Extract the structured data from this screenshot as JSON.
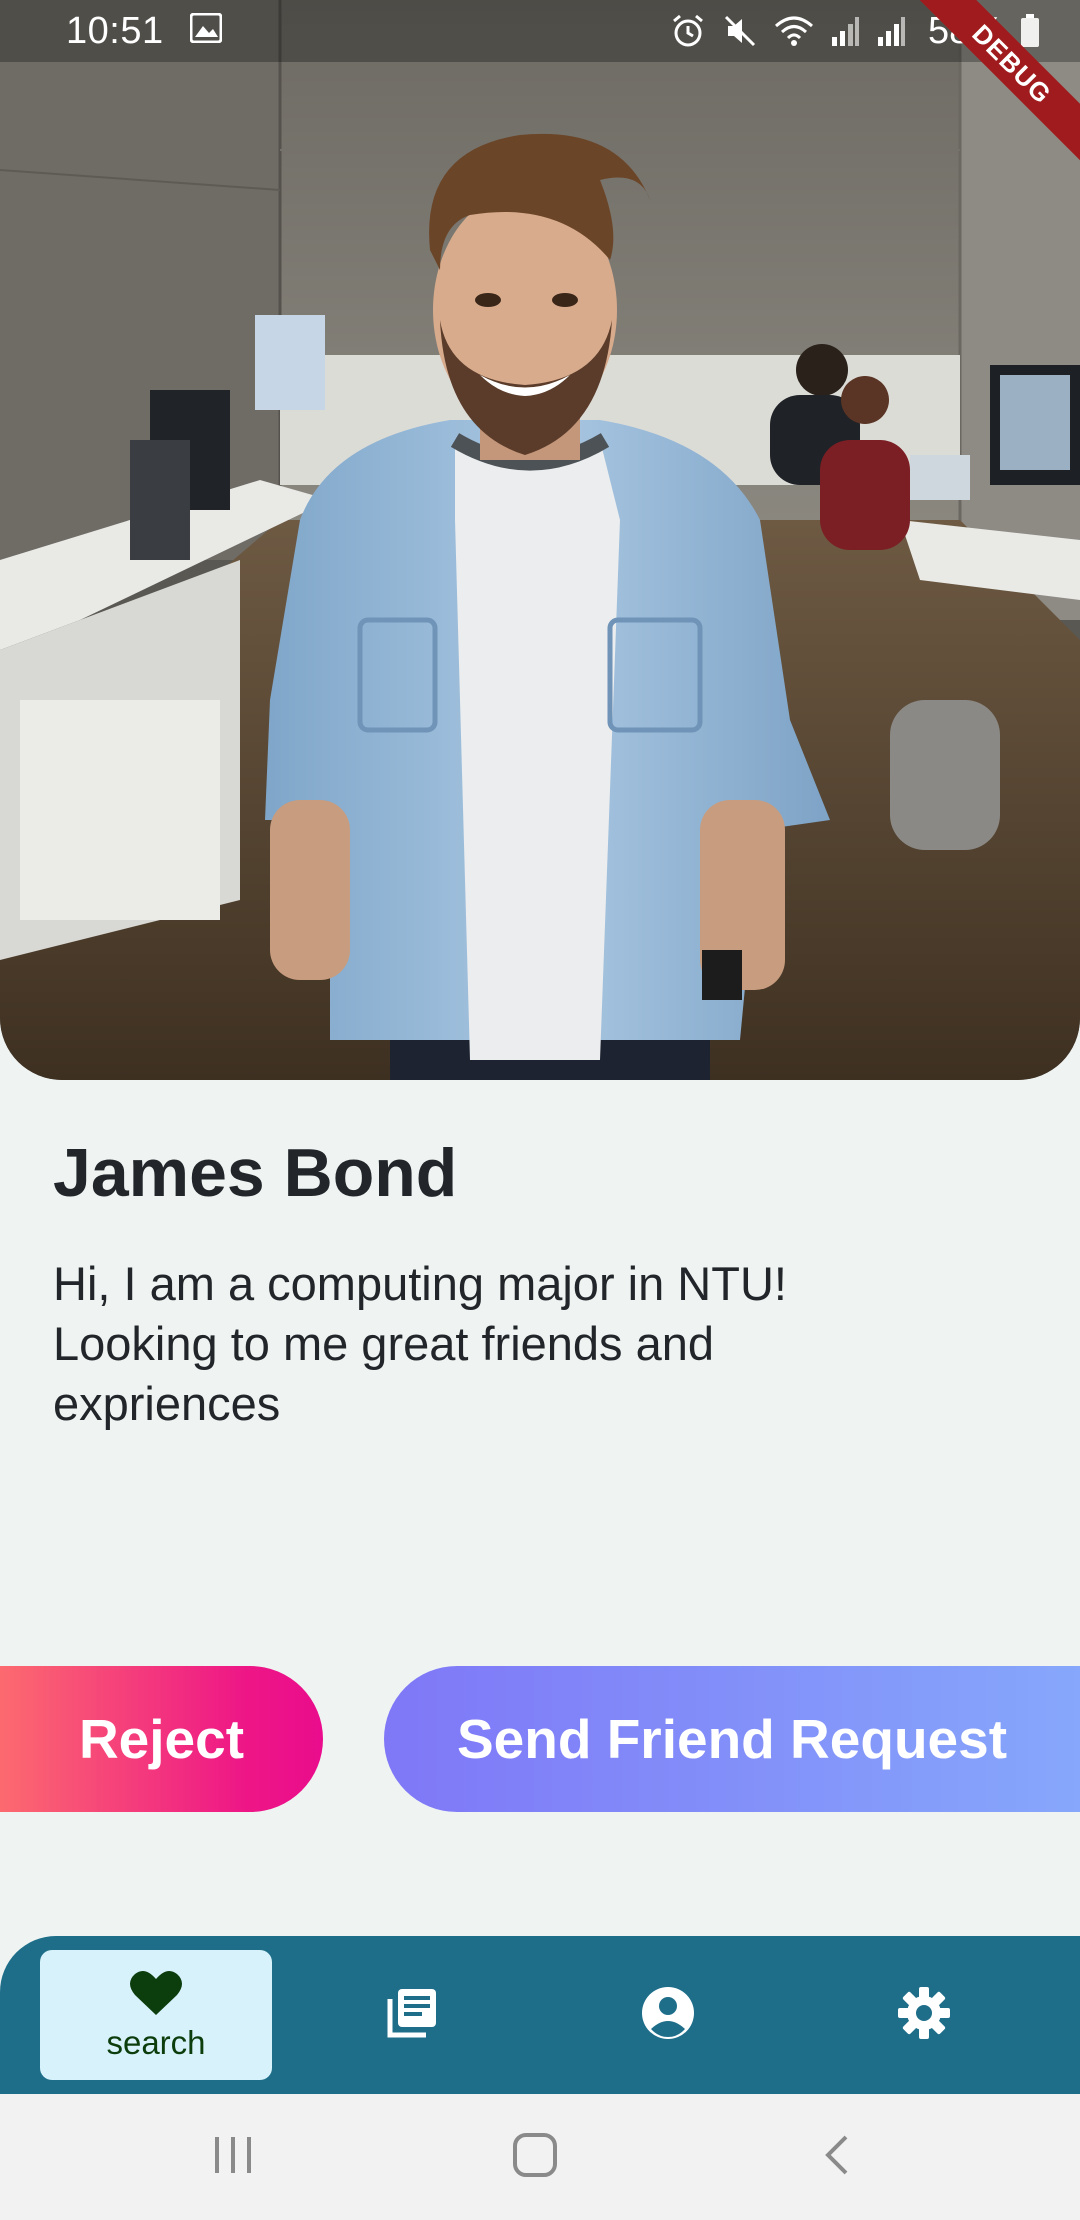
{
  "status_bar": {
    "time": "10:51",
    "battery_text": "58%",
    "left_icons": [
      "image-icon"
    ],
    "right_icons": [
      "alarm-icon",
      "mute-icon",
      "wifi-icon",
      "signal-icon",
      "signal-icon",
      "battery-icon"
    ]
  },
  "debug_banner": {
    "label": "DEBUG"
  },
  "profile": {
    "name": "James Bond",
    "bio": "Hi, I am a computing major in NTU! Looking to me great friends and expriences"
  },
  "actions": {
    "reject_label": "Reject",
    "request_label": "Send Friend Request"
  },
  "bottom_nav": {
    "items": [
      {
        "icon": "heart-icon",
        "label": "search",
        "active": true
      },
      {
        "icon": "feed-icon",
        "label": "",
        "active": false
      },
      {
        "icon": "account-circle-icon",
        "label": "",
        "active": false
      },
      {
        "icon": "gear-icon",
        "label": "",
        "active": false
      }
    ]
  },
  "system_nav": {
    "items": [
      "recents-icon",
      "home-icon",
      "back-icon"
    ]
  },
  "colors": {
    "background": "#eff4f3",
    "nav_bar": "#1e6e8a",
    "nav_active": "#d7f2fb",
    "reject_gradient": [
      "#fc6a6f",
      "#ea0c8c"
    ],
    "request_gradient": [
      "#7f77f7",
      "#86a7fb"
    ],
    "debug": "#a01b1e"
  }
}
